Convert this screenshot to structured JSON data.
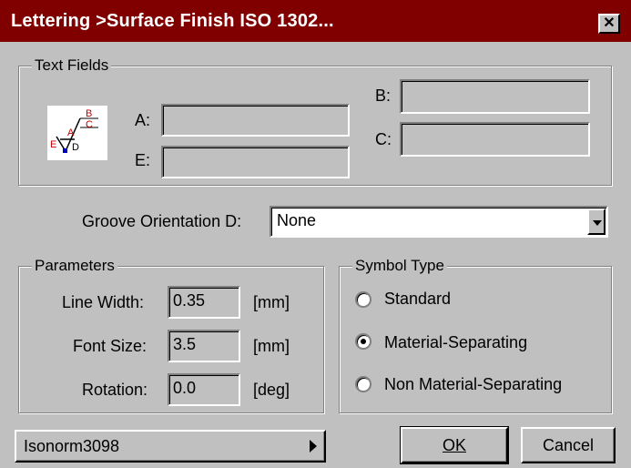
{
  "window": {
    "title": "Lettering >Surface Finish ISO 1302...",
    "close_label": "✕"
  },
  "text_fields": {
    "legend": "Text Fields",
    "icon": "surface-finish-symbol-icon",
    "a_label": "A:",
    "b_label": "B:",
    "c_label": "C:",
    "e_label": "E:",
    "a_value": "",
    "b_value": "",
    "c_value": "",
    "e_value": ""
  },
  "groove": {
    "label": "Groove Orientation D:",
    "selected": "None"
  },
  "parameters": {
    "legend": "Parameters",
    "line_width_label": "Line Width:",
    "line_width_value": "0.35",
    "line_width_unit": "[mm]",
    "font_size_label": "Font Size:",
    "font_size_value": "3.5",
    "font_size_unit": "[mm]",
    "rotation_label": "Rotation:",
    "rotation_value": "0.0",
    "rotation_unit": "[deg]"
  },
  "symbol_type": {
    "legend": "Symbol Type",
    "options": [
      "Standard",
      "Material-Separating",
      "Non Material-Separating"
    ],
    "selected_index": 1
  },
  "footer": {
    "font_menu": "Isonorm3098",
    "ok_label": "OK",
    "cancel_label": "Cancel"
  },
  "colors": {
    "titlebar": "#800000",
    "background": "#c0c0c0"
  }
}
